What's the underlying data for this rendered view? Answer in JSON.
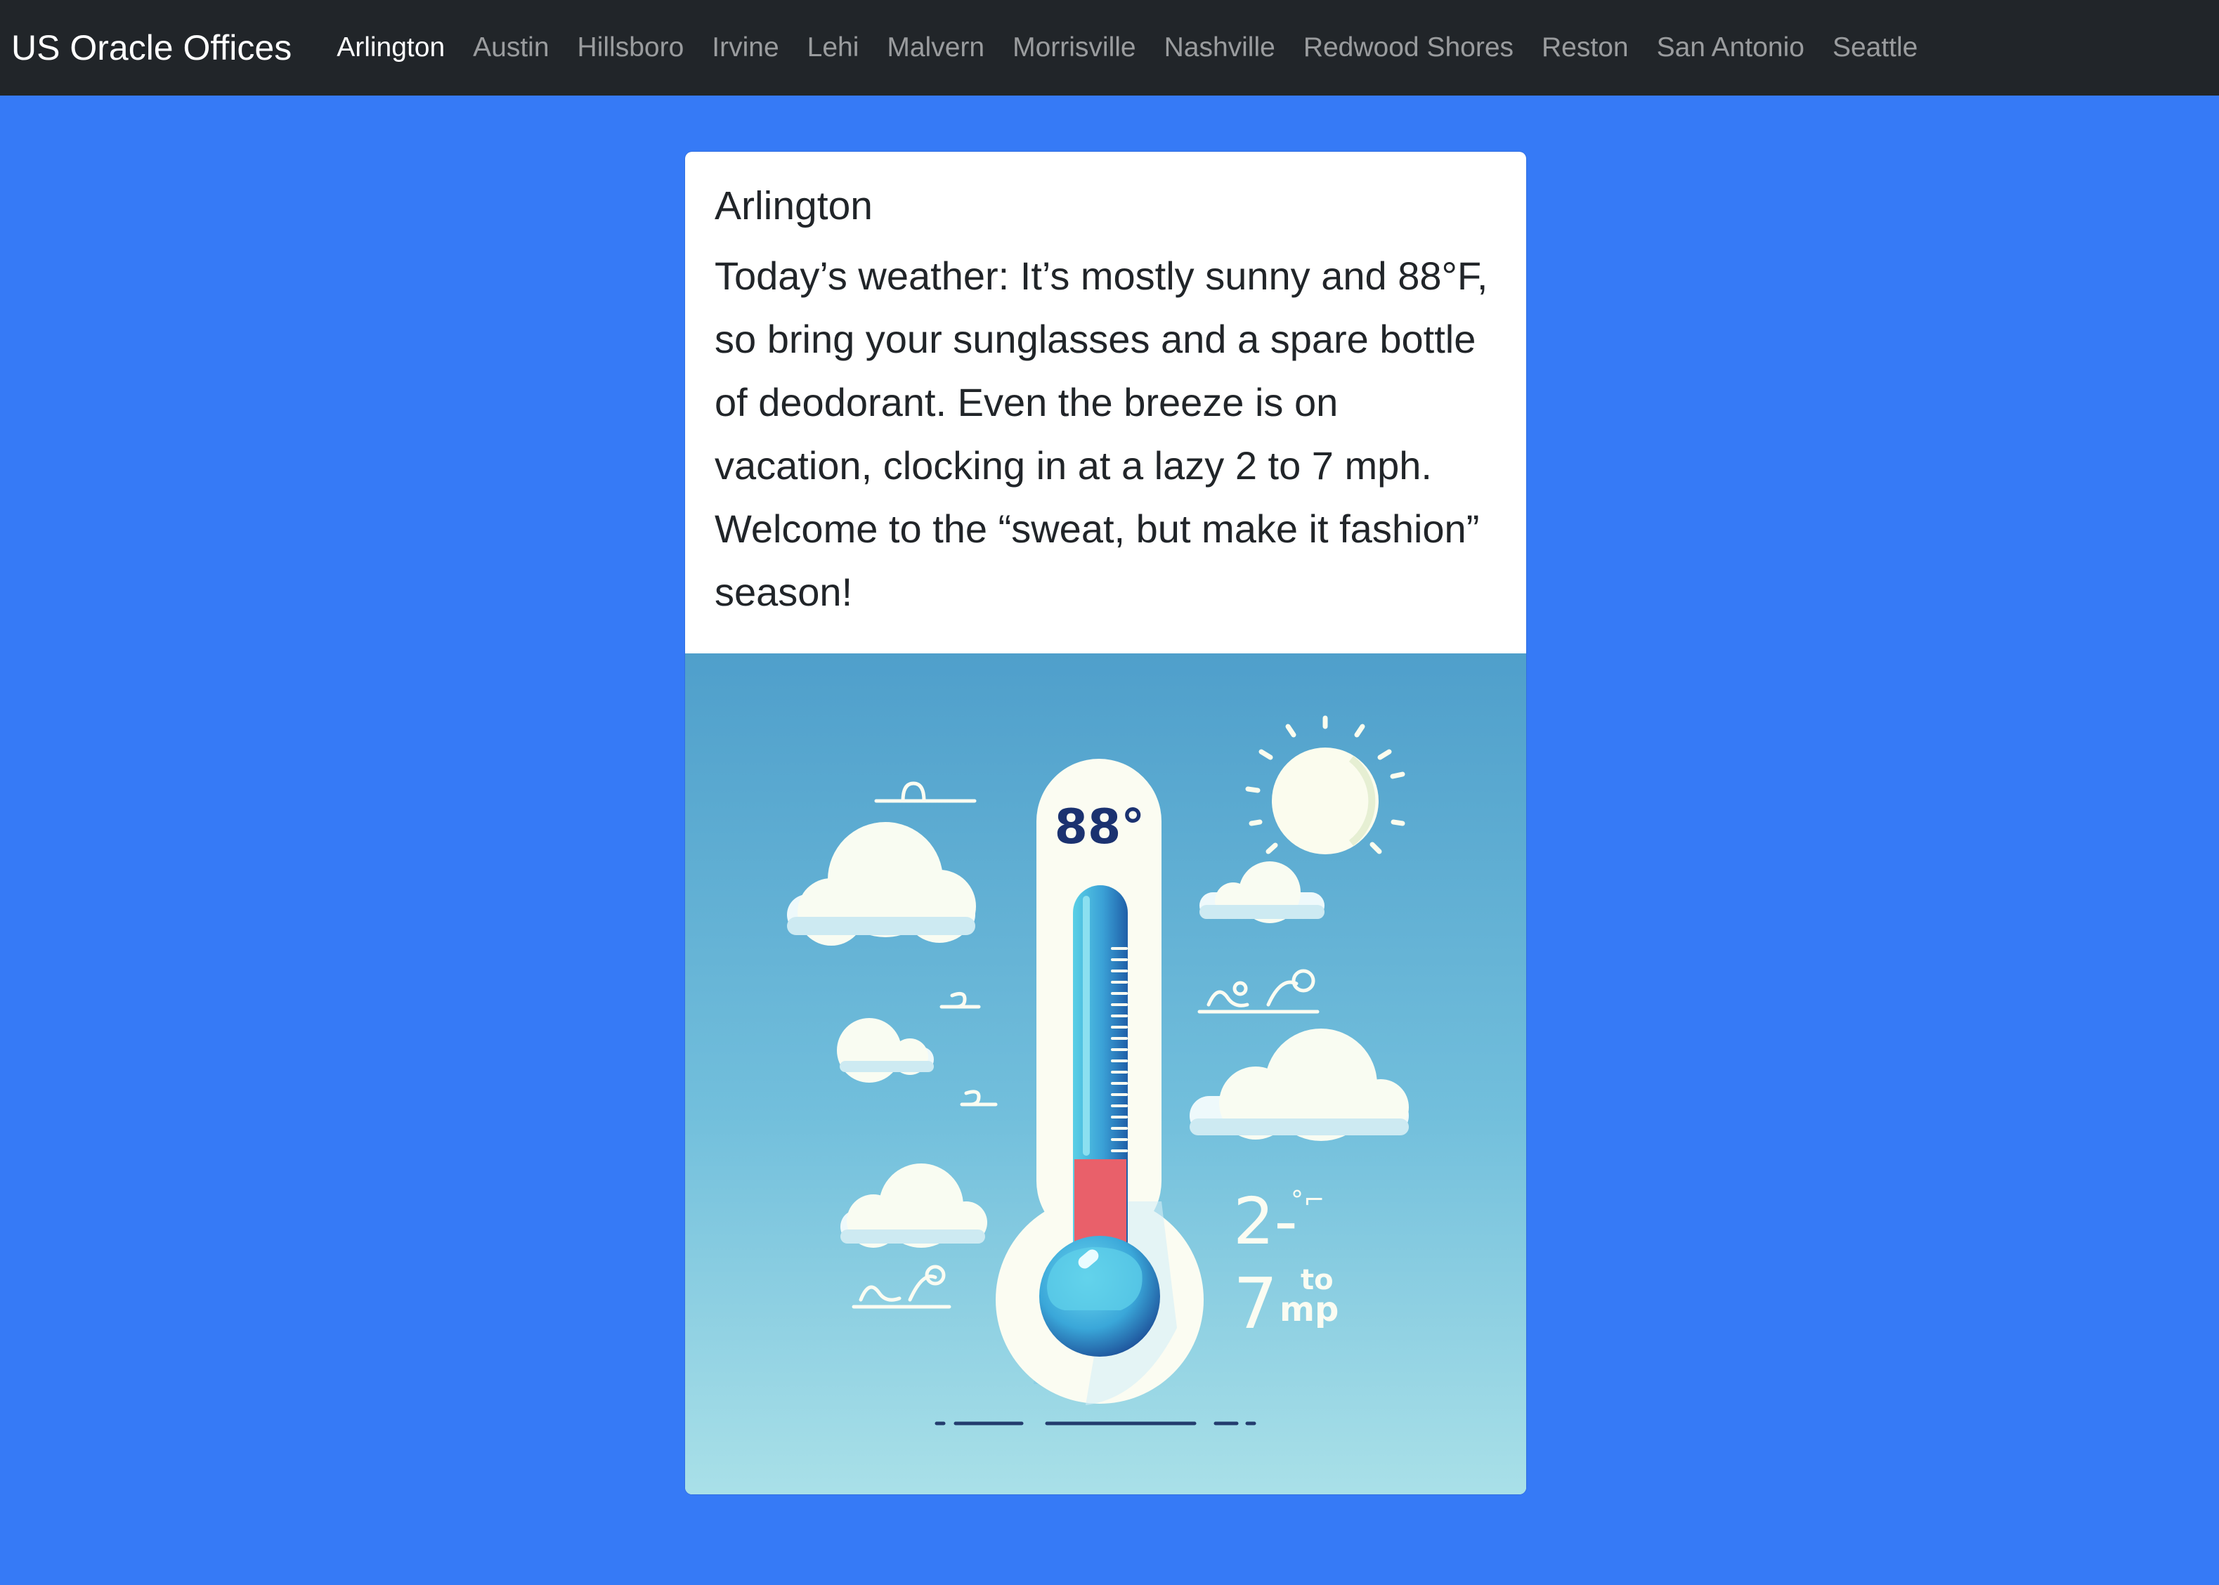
{
  "navbar": {
    "brand": "US Oracle Offices",
    "links": [
      {
        "label": "Arlington",
        "active": true
      },
      {
        "label": "Austin"
      },
      {
        "label": "Hillsboro"
      },
      {
        "label": "Irvine"
      },
      {
        "label": "Lehi"
      },
      {
        "label": "Malvern"
      },
      {
        "label": "Morrisville"
      },
      {
        "label": "Nashville"
      },
      {
        "label": "Redwood Shores"
      },
      {
        "label": "Reston"
      },
      {
        "label": "San Antonio"
      },
      {
        "label": "Seattle"
      }
    ]
  },
  "card": {
    "title": "Arlington",
    "text": "Today’s weather: It’s mostly sunny and 88°F, so bring your sunglasses and a spare bottle of deodorant. Even the breeze is on vacation, clocking in at a lazy 2 to 7 mph. Welcome to the “sweat, but make it fashion” season!",
    "image": {
      "temperature_label": "88°",
      "wind_top": "2-",
      "wind_bottom": "7",
      "wind_to": "to",
      "wind_unit": "mp"
    }
  },
  "colors": {
    "page_background": "#367af6",
    "navbar_background": "#212529",
    "sky_top": "#4f9fcb",
    "sky_bottom": "#a9e0e8",
    "mercury": "#e9606a"
  }
}
